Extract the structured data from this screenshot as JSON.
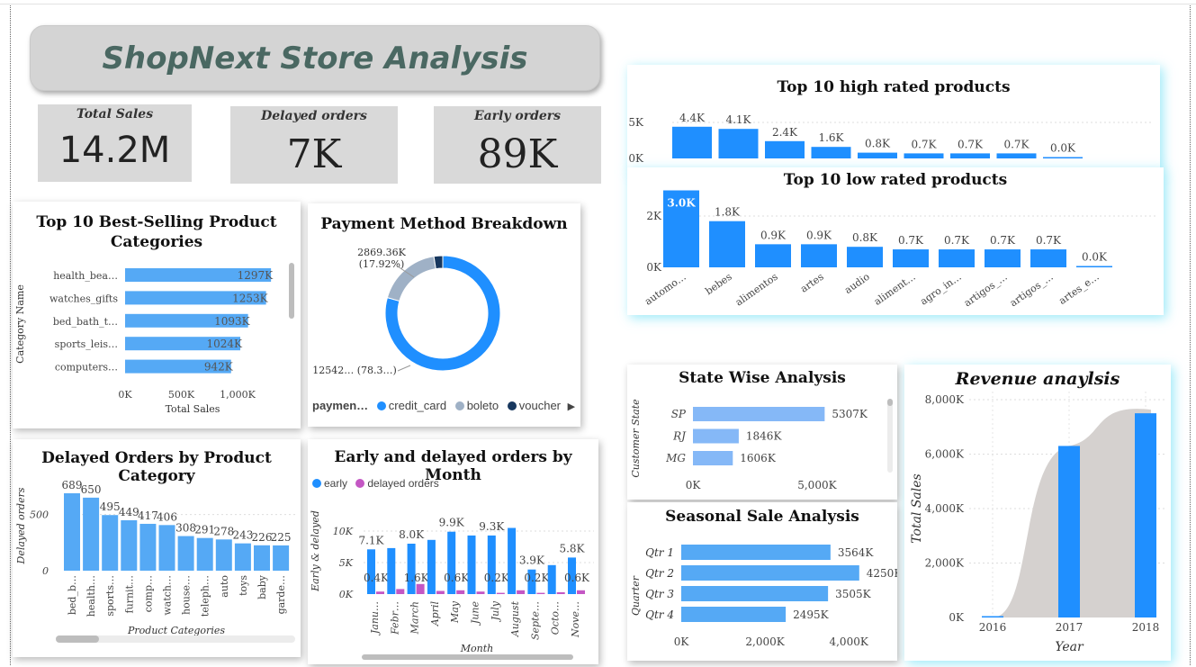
{
  "colors": {
    "bar": "#1f8fff",
    "bar_light": "#55a9f5",
    "bar_state": "#85b8f7",
    "purple": "#c457c4",
    "area": "#d5d1cf",
    "donut_grey": "#9fb1c6",
    "donut_navy": "#17375e"
  },
  "header": {
    "title": "ShopNext Store Analysis"
  },
  "kpis": [
    {
      "label": "Total Sales",
      "value": "14.2M"
    },
    {
      "label": "Delayed orders",
      "value": "7K"
    },
    {
      "label": "Early orders",
      "value": "89K"
    }
  ],
  "chart_data": [
    {
      "id": "best_selling",
      "type": "bar",
      "orientation": "horizontal",
      "title": "Top 10 Best-Selling Product Categories",
      "xlabel": "Total Sales",
      "ylabel": "Category Name",
      "categories": [
        "health_bea…",
        "watches_gifts",
        "bed_bath_t…",
        "sports_leis…",
        "computers…"
      ],
      "values": [
        1297,
        1253,
        1093,
        1024,
        942
      ],
      "data_labels": [
        "1297K",
        "1253K",
        "1093K",
        "1024K",
        "942K"
      ],
      "xticks": [
        "0K",
        "500K",
        "1,000K"
      ],
      "xlim": [
        0,
        1400
      ]
    },
    {
      "id": "payment",
      "type": "pie",
      "donut": true,
      "title": "Payment Method Breakdown",
      "labels": [
        "credit_card",
        "boleto",
        "voucher"
      ],
      "values": [
        12542,
        2869.36,
        390
      ],
      "slice_labels": [
        "12542… (78.3…)",
        "2869.36K\n(17.92%)"
      ],
      "legend_title": "paymen…"
    },
    {
      "id": "high_rated",
      "type": "bar",
      "title": "Top 10 high rated products",
      "values": [
        4.4,
        4.1,
        2.4,
        1.6,
        0.8,
        0.7,
        0.7,
        0.7,
        0.04
      ],
      "data_labels": [
        "4.4K",
        "4.1K",
        "2.4K",
        "1.6K",
        "0.8K",
        "0.7K",
        "0.7K",
        "0.7K",
        "0.0K"
      ],
      "yticks": [
        "5K",
        "0K"
      ],
      "ylim": [
        0,
        5
      ]
    },
    {
      "id": "low_rated",
      "type": "bar",
      "title": "Top 10 low rated products",
      "categories": [
        "automo…",
        "bebes",
        "alimentos",
        "artes",
        "audio",
        "aliment…",
        "agro_in…",
        "artigos_…",
        "artigos_…",
        "artes_e…"
      ],
      "values": [
        3.0,
        1.8,
        0.9,
        0.9,
        0.8,
        0.7,
        0.7,
        0.7,
        0.7,
        0.04
      ],
      "data_labels": [
        "3.0K",
        "1.8K",
        "0.9K",
        "0.9K",
        "0.8K",
        "0.7K",
        "0.7K",
        "0.7K",
        "0.7K",
        "0.0K"
      ],
      "yticks": [
        "2K",
        "0K"
      ],
      "ylim": [
        0,
        3.2
      ]
    },
    {
      "id": "delayed_by_cat",
      "type": "bar",
      "title": "Delayed Orders by Product Category",
      "xlabel": "Product Categories",
      "ylabel": "Delayed orders",
      "categories": [
        "bed_b…",
        "health…",
        "sports…",
        "furnit…",
        "comp…",
        "watch…",
        "house…",
        "teleph…",
        "auto",
        "toys",
        "baby",
        "garde…"
      ],
      "values": [
        689,
        650,
        495,
        449,
        417,
        406,
        308,
        291,
        278,
        243,
        226,
        225
      ],
      "yticks": [
        "500",
        "0"
      ],
      "ylim": [
        0,
        760
      ]
    },
    {
      "id": "by_month",
      "type": "bar",
      "title": "Early and delayed orders by Month",
      "xlabel": "Month",
      "ylabel": "Early & delayed",
      "categories": [
        "Janu…",
        "Febr…",
        "March",
        "April",
        "May",
        "June",
        "July",
        "August",
        "Septe…",
        "Octo…",
        "Nove…"
      ],
      "series": [
        {
          "name": "early",
          "values": [
            7.1,
            7.3,
            8.0,
            8.6,
            9.9,
            9.3,
            9.3,
            10.5,
            3.9,
            4.6,
            5.8
          ]
        },
        {
          "name": "delayed orders",
          "values": [
            0.4,
            0.8,
            1.6,
            0.5,
            0.6,
            0.4,
            0.2,
            0.6,
            0.2,
            0.3,
            0.6
          ]
        }
      ],
      "data_labels": [
        "7.1K",
        "0.4K",
        "8.0K",
        "1.6K",
        "9.9K",
        "0.6K",
        "9.3K",
        "0.2K",
        "3.9K",
        "0.2K",
        "5.8K",
        "0.6K"
      ],
      "yticks": [
        "10K",
        "5K",
        "0K"
      ],
      "ylim": [
        0,
        12
      ]
    },
    {
      "id": "state",
      "type": "bar",
      "orientation": "horizontal",
      "title": "State Wise Analysis",
      "ylabel": "Customer State",
      "categories": [
        "SP",
        "RJ",
        "MG"
      ],
      "values": [
        5307,
        1846,
        1606
      ],
      "data_labels": [
        "5307K",
        "1846K",
        "1606K"
      ],
      "xticks": [
        "0K",
        "5,000K"
      ],
      "xlim": [
        0,
        6200
      ]
    },
    {
      "id": "seasonal",
      "type": "bar",
      "orientation": "horizontal",
      "title": "Seasonal Sale Analysis",
      "ylabel": "Quarter",
      "categories": [
        "Qtr 1",
        "Qtr 2",
        "Qtr 3",
        "Qtr 4"
      ],
      "values": [
        3564,
        4250,
        3505,
        2495
      ],
      "data_labels": [
        "3564K",
        "4250K",
        "3505K",
        "2495K"
      ],
      "xticks": [
        "0K",
        "2,000K",
        "4,000K"
      ],
      "xlim": [
        0,
        5200
      ]
    },
    {
      "id": "revenue",
      "type": "bar",
      "title": "Revenue anaylsis",
      "xlabel": "Year",
      "ylabel": "Total Sales",
      "categories": [
        "2016",
        "2017",
        "2018"
      ],
      "values": [
        50,
        6300,
        7500
      ],
      "yticks": [
        "8,000K",
        "6,000K",
        "4,000K",
        "2,000K",
        "0K"
      ],
      "ylim": [
        0,
        8500
      ]
    }
  ],
  "legends": {
    "payment": [
      "credit_card",
      "boleto",
      "voucher"
    ],
    "month": [
      "early",
      "delayed orders"
    ]
  }
}
